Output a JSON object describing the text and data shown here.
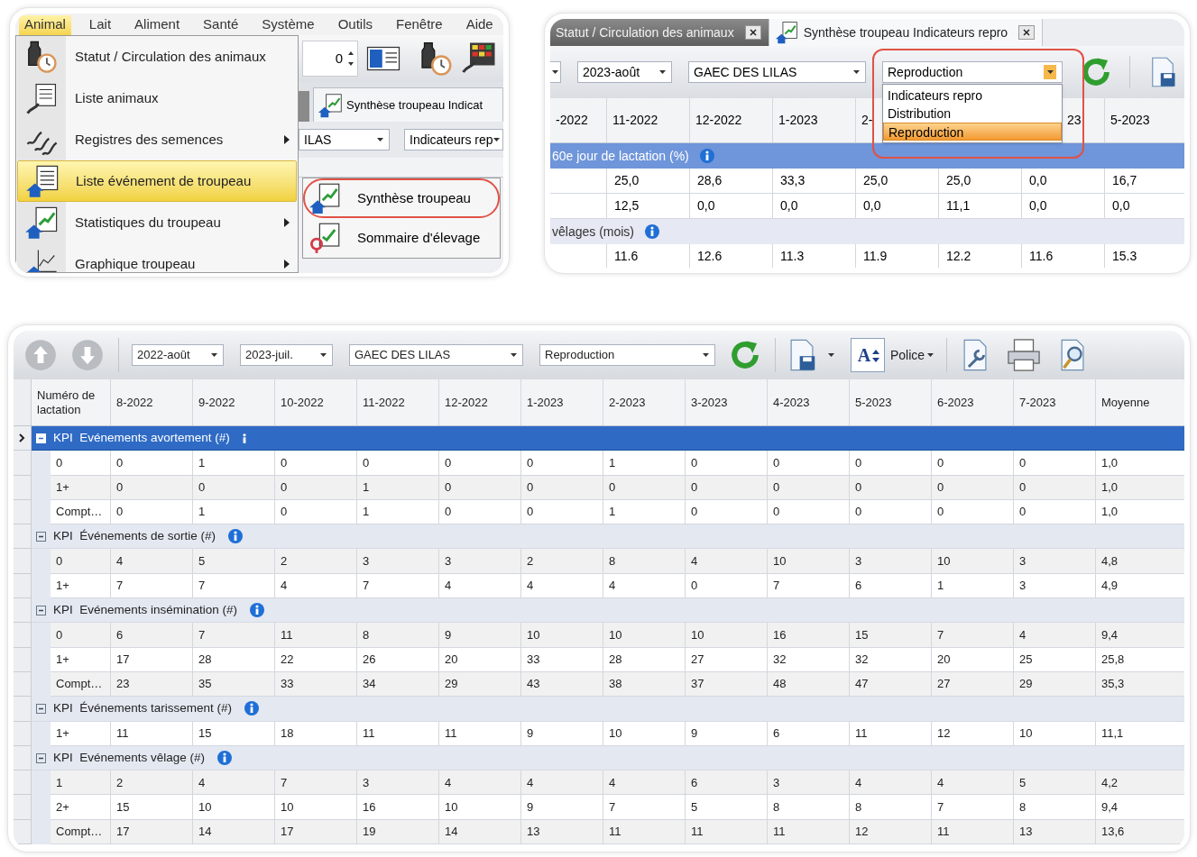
{
  "menu_screen": {
    "menubar": [
      {
        "label": "Animal",
        "selected": true
      },
      {
        "label": "Lait",
        "selected": false
      },
      {
        "label": "Aliment",
        "selected": false
      },
      {
        "label": "Santé",
        "selected": false
      },
      {
        "label": "Système",
        "selected": false
      },
      {
        "label": "Outils",
        "selected": false
      },
      {
        "label": "Fenêtre",
        "selected": false
      },
      {
        "label": "Aide",
        "selected": false
      }
    ],
    "menu_items": [
      {
        "label": "Statut / Circulation des animaux",
        "selected": false,
        "submenu": false
      },
      {
        "label": "Liste animaux",
        "selected": false,
        "submenu": false
      },
      {
        "label": "Registres des semences",
        "selected": false,
        "submenu": true
      },
      {
        "label": "Liste événement de troupeau",
        "selected": true,
        "submenu": false
      },
      {
        "label": "Statistiques du troupeau",
        "selected": false,
        "submenu": true
      },
      {
        "label": "Graphique troupeau",
        "selected": false,
        "submenu": true
      }
    ],
    "spinner_value": "0",
    "tab_label": "Synthèse troupeau Indicat",
    "combos": [
      "ILAS",
      "Indicateurs rep"
    ],
    "submenu_items": [
      {
        "label": "Synthèse troupeau",
        "circled": true
      },
      {
        "label": "Sommaire d'élevage",
        "circled": false
      }
    ]
  },
  "report_screen": {
    "tabs": [
      {
        "label": "Statut / Circulation des animaux",
        "selected": false
      },
      {
        "label": "Synthèse troupeau Indicateurs repro",
        "selected": true
      }
    ],
    "combos": [
      "2023-août",
      "GAEC DES LILAS"
    ],
    "report_combo": {
      "value": "Reproduction",
      "open": true,
      "circled": true,
      "options": [
        {
          "label": "Indicateurs repro",
          "selected": false
        },
        {
          "label": "Distribution",
          "selected": false
        },
        {
          "label": "Reproduction",
          "selected": true
        }
      ]
    },
    "columns": [
      "-2022",
      "11-2022",
      "12-2022",
      "1-2023",
      "2-",
      "23",
      "5-2023"
    ],
    "rows": [
      {
        "kind": "group",
        "label": "60e jour de lactation (%)",
        "selected": true
      },
      {
        "kind": "data",
        "values": [
          "25,0",
          "28,6",
          "33,3",
          "25,0",
          "25,0",
          "0,0",
          "16,7"
        ]
      },
      {
        "kind": "data",
        "values": [
          "12,5",
          "0,0",
          "0,0",
          "0,0",
          "11,1",
          "0,0",
          "0,0"
        ]
      },
      {
        "kind": "group",
        "label": "vêlages (mois)",
        "selected": false
      },
      {
        "kind": "data",
        "values": [
          "11.6",
          "12.6",
          "11.3",
          "11.9",
          "12.2",
          "11.6",
          "15.3"
        ]
      }
    ]
  },
  "main_screen": {
    "toolbar": {
      "nav_buttons": [
        {
          "disabled": true
        },
        {
          "disabled": true
        }
      ],
      "combos": [
        "2022-août",
        "2023-juil.",
        "GAEC DES LILAS",
        "Reproduction"
      ],
      "font_glyph": "A",
      "font_menu": "Police"
    },
    "table": {
      "columns": [
        "Numéro de lactation",
        "8-2022",
        "9-2022",
        "10-2022",
        "11-2022",
        "12-2022",
        "1-2023",
        "2-2023",
        "3-2023",
        "4-2023",
        "5-2023",
        "6-2023",
        "7-2023",
        "Moyenne"
      ],
      "groups": [
        {
          "label": "KPI  Evénements avortement (#)",
          "selected": true,
          "expanded": true,
          "rows": [
            {
              "label": "0",
              "values": [
                "0",
                "1",
                "0",
                "0",
                "0",
                "0",
                "1",
                "0",
                "0",
                "0",
                "0",
                "0",
                "1,0"
              ]
            },
            {
              "label": "1+",
              "values": [
                "0",
                "0",
                "0",
                "1",
                "0",
                "0",
                "0",
                "0",
                "0",
                "0",
                "0",
                "0",
                "1,0"
              ]
            },
            {
              "label": "Compt…",
              "values": [
                "0",
                "1",
                "0",
                "1",
                "0",
                "0",
                "1",
                "0",
                "0",
                "0",
                "0",
                "0",
                "1,0"
              ]
            }
          ]
        },
        {
          "label": "KPI  Événements de sortie (#)",
          "selected": false,
          "expanded": true,
          "rows": [
            {
              "label": "0",
              "values": [
                "4",
                "5",
                "2",
                "3",
                "3",
                "2",
                "8",
                "4",
                "10",
                "3",
                "10",
                "3",
                "4,8"
              ]
            },
            {
              "label": "1+",
              "values": [
                "7",
                "7",
                "4",
                "7",
                "4",
                "4",
                "4",
                "0",
                "7",
                "6",
                "1",
                "3",
                "4,9"
              ]
            }
          ]
        },
        {
          "label": "KPI  Evénements insémination (#)",
          "selected": false,
          "expanded": true,
          "rows": [
            {
              "label": "0",
              "values": [
                "6",
                "7",
                "11",
                "8",
                "9",
                "10",
                "10",
                "10",
                "16",
                "15",
                "7",
                "4",
                "9,4"
              ]
            },
            {
              "label": "1+",
              "values": [
                "17",
                "28",
                "22",
                "26",
                "20",
                "33",
                "28",
                "27",
                "32",
                "32",
                "20",
                "25",
                "25,8"
              ]
            },
            {
              "label": "Compt…",
              "values": [
                "23",
                "35",
                "33",
                "34",
                "29",
                "43",
                "38",
                "37",
                "48",
                "47",
                "27",
                "29",
                "35,3"
              ]
            }
          ]
        },
        {
          "label": "KPI  Événements tarissement (#)",
          "selected": false,
          "expanded": true,
          "rows": [
            {
              "label": "1+",
              "values": [
                "11",
                "15",
                "18",
                "11",
                "11",
                "9",
                "10",
                "9",
                "6",
                "11",
                "12",
                "10",
                "11,1"
              ]
            }
          ]
        },
        {
          "label": "KPI  Evénements vêlage (#)",
          "selected": false,
          "expanded": true,
          "rows": [
            {
              "label": "1",
              "values": [
                "2",
                "4",
                "7",
                "3",
                "4",
                "4",
                "4",
                "6",
                "3",
                "4",
                "4",
                "5",
                "4,2"
              ]
            },
            {
              "label": "2+",
              "values": [
                "15",
                "10",
                "10",
                "16",
                "10",
                "9",
                "7",
                "5",
                "8",
                "8",
                "7",
                "8",
                "9,4"
              ]
            },
            {
              "label": "Compt…",
              "values": [
                "17",
                "14",
                "17",
                "19",
                "14",
                "13",
                "11",
                "11",
                "11",
                "12",
                "11",
                "13",
                "13,6"
              ]
            }
          ]
        }
      ]
    }
  }
}
